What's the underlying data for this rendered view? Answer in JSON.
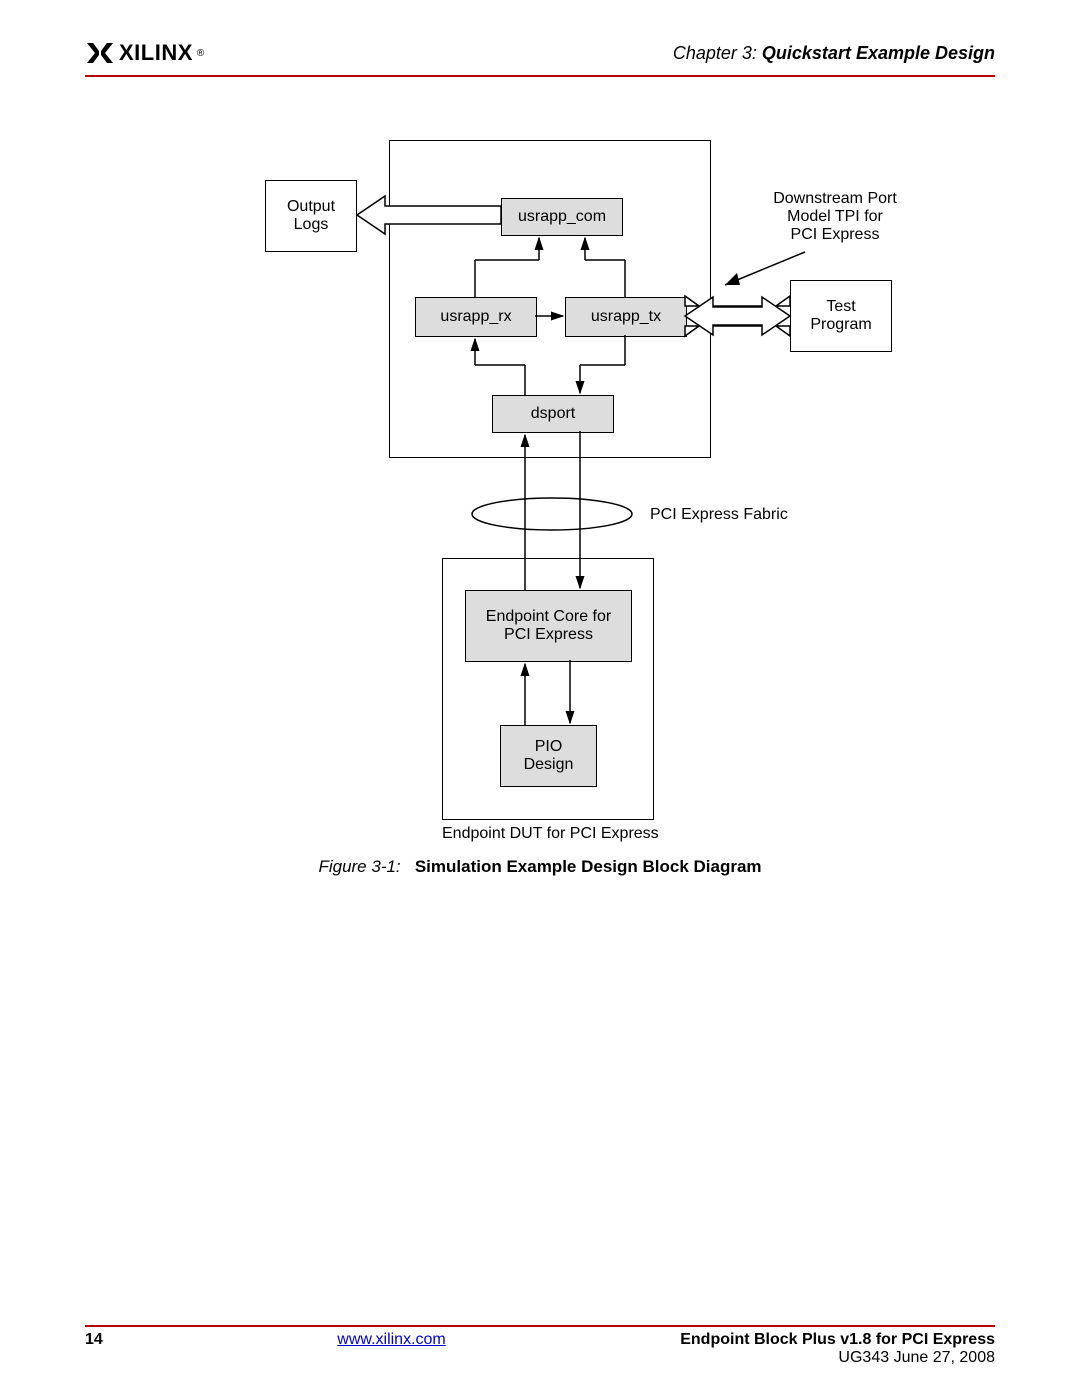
{
  "header": {
    "logo_text": "XILINX",
    "chapter_prefix": "Chapter 3:",
    "chapter_title": "Quickstart Example Design"
  },
  "diagram": {
    "output_logs": "Output\nLogs",
    "usrapp_com": "usrapp_com",
    "usrapp_rx": "usrapp_rx",
    "usrapp_tx": "usrapp_tx",
    "dsport": "dsport",
    "test_program": "Test\nProgram",
    "downstream_label": "Downstream Port\nModel TPI for\nPCI Express",
    "fabric_label": "PCI Express Fabric",
    "endpoint_core": "Endpoint Core for\nPCI Express",
    "pio_design": "PIO\nDesign",
    "endpoint_dut": "Endpoint DUT for PCI Express"
  },
  "caption": {
    "figure": "Figure 3-1:",
    "title": "Simulation Example Design Block Diagram"
  },
  "footer": {
    "page": "14",
    "link": "www.xilinx.com",
    "doc_title": "Endpoint Block Plus v1.8 for PCI Express",
    "doc_id": "UG343 June 27, 2008"
  }
}
